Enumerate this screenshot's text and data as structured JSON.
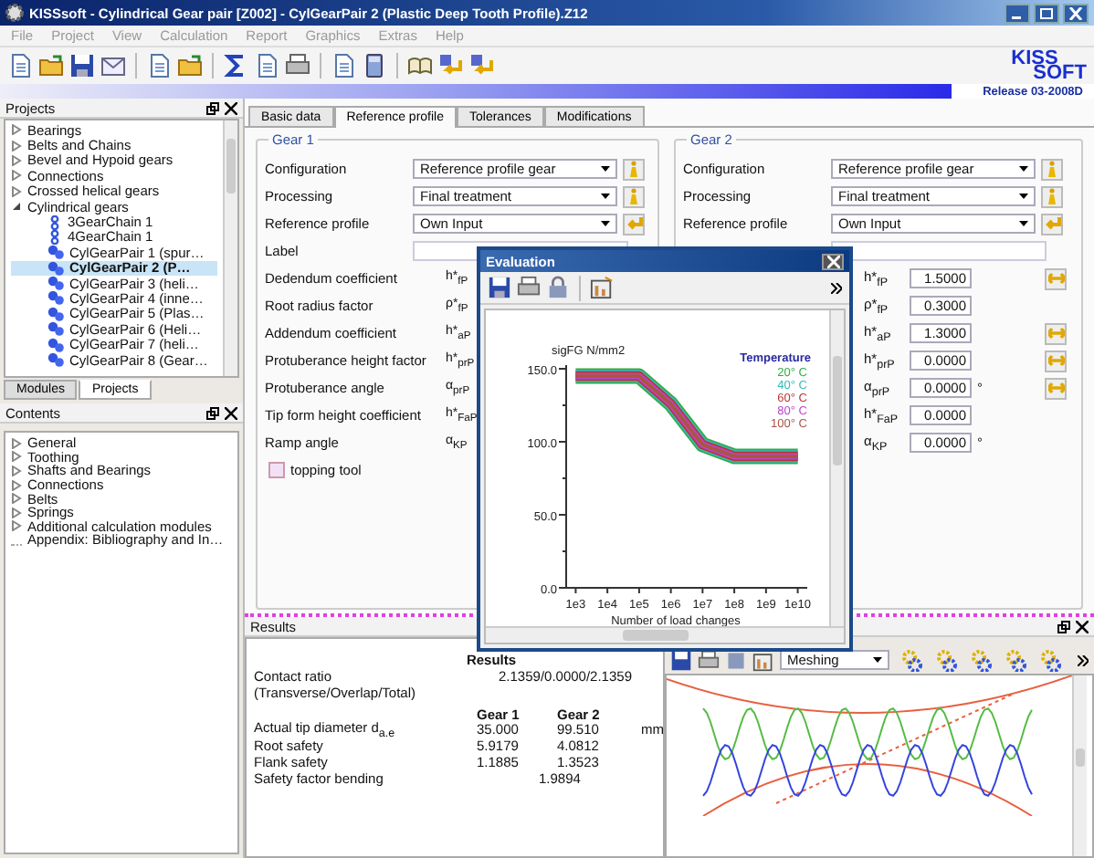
{
  "window": {
    "title": "KISSsoft - Cylindrical Gear pair [Z002] - CylGearPair 2 (Plastic Deep Tooth Profile).Z12"
  },
  "menu": [
    "File",
    "Project",
    "View",
    "Calculation",
    "Report",
    "Graphics",
    "Extras",
    "Help"
  ],
  "logo": {
    "top": "KISS",
    "bottom": "SOFT"
  },
  "release": "Release 03-2008D",
  "projects_panel": {
    "title": "Projects",
    "tree": [
      {
        "label": "Bearings",
        "expanded": false
      },
      {
        "label": "Belts and Chains",
        "expanded": false
      },
      {
        "label": "Bevel and Hypoid gears",
        "expanded": false
      },
      {
        "label": "Connections",
        "expanded": false
      },
      {
        "label": "Crossed helical gears",
        "expanded": false
      },
      {
        "label": "Cylindrical gears",
        "expanded": true,
        "children": [
          {
            "label": "3GearChain 1",
            "kind": "chain",
            "selected": false
          },
          {
            "label": "4GearChain 1",
            "kind": "chain",
            "selected": false
          },
          {
            "label": "CylGearPair 1 (spur…",
            "kind": "pair",
            "selected": false
          },
          {
            "label": "CylGearPair 2 (P…",
            "kind": "pair",
            "selected": true
          },
          {
            "label": "CylGearPair 3 (heli…",
            "kind": "pair",
            "selected": false
          },
          {
            "label": "CylGearPair 4 (inne…",
            "kind": "pair",
            "selected": false
          },
          {
            "label": "CylGearPair 5 (Plas…",
            "kind": "pair",
            "selected": false
          },
          {
            "label": "CylGearPair 6 (Heli…",
            "kind": "pair",
            "selected": false
          },
          {
            "label": "CylGearPair 7 (heli…",
            "kind": "pair",
            "selected": false
          },
          {
            "label": "CylGearPair 8 (Gear…",
            "kind": "pair",
            "selected": false
          }
        ]
      }
    ],
    "tabs": [
      {
        "label": "Modules",
        "selected": false
      },
      {
        "label": "Projects",
        "selected": true
      }
    ]
  },
  "contents_panel": {
    "title": "Contents",
    "items": [
      {
        "label": "General",
        "kind": "folder"
      },
      {
        "label": "Toothing",
        "kind": "folder"
      },
      {
        "label": "Shafts and Bearings",
        "kind": "folder"
      },
      {
        "label": "Connections",
        "kind": "folder"
      },
      {
        "label": "Belts",
        "kind": "folder"
      },
      {
        "label": "Springs",
        "kind": "folder"
      },
      {
        "label": "Additional calculation modules",
        "kind": "folder"
      },
      {
        "label": "Appendix: Bibliography and In…",
        "kind": "leaf"
      }
    ]
  },
  "main_tabs": [
    {
      "label": "Basic data",
      "selected": false
    },
    {
      "label": "Reference profile",
      "selected": true
    },
    {
      "label": "Tolerances",
      "selected": false
    },
    {
      "label": "Modifications",
      "selected": false
    }
  ],
  "gear1": {
    "title": "Gear 1",
    "selects": [
      {
        "label": "Configuration",
        "value": "Reference profile gear",
        "kind": "info"
      },
      {
        "label": "Processing",
        "value": "Final treatment",
        "kind": "info"
      },
      {
        "label": "Reference profile",
        "value": "Own Input",
        "kind": "arrow"
      }
    ],
    "label_field": {
      "label": "Label"
    },
    "coefficients": [
      {
        "label": "Dedendum coefficient",
        "symbol": "h*$_{fP}$"
      },
      {
        "label": "Root radius factor",
        "symbol": "ρ*$_{fP}$"
      },
      {
        "label": "Addendum coefficient",
        "symbol": "h*$_{aP}$"
      },
      {
        "label": "Protuberance height factor",
        "symbol": "h*$_{prP}$"
      },
      {
        "label": "Protuberance angle",
        "symbol": "α$_{prP}$"
      },
      {
        "label": "Tip form height coefficient",
        "symbol": "h*$_{FaP}$"
      },
      {
        "label": "Ramp angle",
        "symbol": "α$_{KP}$"
      }
    ],
    "topping_tool": {
      "label": "topping tool",
      "checked": false
    }
  },
  "gear2": {
    "title": "Gear 2",
    "selects": [
      {
        "label": "Configuration",
        "value": "Reference profile gear",
        "kind": "info"
      },
      {
        "label": "Processing",
        "value": "Final treatment",
        "kind": "info"
      },
      {
        "label": "Reference profile",
        "value": "Own Input",
        "kind": "arrow"
      }
    ],
    "coefficients": [
      {
        "symbol": "h*$_{fP}$",
        "value": "1.5000",
        "button": true
      },
      {
        "symbol": "ρ*$_{fP}$",
        "value": "0.3000",
        "button": false
      },
      {
        "symbol": "h*$_{aP}$",
        "value": "1.3000",
        "button": true
      },
      {
        "symbol": "h*$_{prP}$",
        "value": "0.0000",
        "button": true
      },
      {
        "symbol": "α$_{prP}$",
        "value": "0.0000",
        "unit": "°",
        "button": true
      },
      {
        "symbol": "h*$_{FaP}$",
        "value": "0.0000",
        "button": false
      },
      {
        "symbol": "α$_{KP}$",
        "value": "0.0000",
        "unit": "°",
        "button": false
      }
    ]
  },
  "dialog": {
    "title": "Evaluation",
    "legend_title": "Temperature",
    "chart_data": {
      "type": "line",
      "ylabel": "sigFG N/mm2",
      "xlabel": "Number of load changes",
      "categories": [
        "1e3",
        "1e4",
        "1e5",
        "1e6",
        "1e7",
        "1e8",
        "1e9",
        "1e10"
      ],
      "series": [
        {
          "name": "20° C",
          "color": "#33aa44",
          "values": [
            145,
            145,
            145,
            126,
            98,
            90,
            90,
            90
          ]
        },
        {
          "name": "40° C",
          "color": "#33bbbb",
          "values": [
            145,
            145,
            145,
            126,
            98,
            90,
            90,
            90
          ]
        },
        {
          "name": "60° C",
          "color": "#bb3333",
          "values": [
            145,
            145,
            145,
            126,
            98,
            90,
            90,
            90
          ]
        },
        {
          "name": "80° C",
          "color": "#bb44cc",
          "values": [
            145,
            145,
            145,
            126,
            98,
            90,
            90,
            90
          ]
        },
        {
          "name": "100° C",
          "color": "#aa5544",
          "values": [
            145,
            145,
            145,
            126,
            98,
            90,
            90,
            90
          ]
        }
      ],
      "ylim": [
        0,
        150
      ],
      "yticks": [
        {
          "value": 0,
          "label": "0.0"
        },
        {
          "value": 50,
          "label": "50.0"
        },
        {
          "value": 100,
          "label": "100.0"
        },
        {
          "value": 150,
          "label": "150.0"
        }
      ]
    }
  },
  "results_panel": {
    "title": "Results",
    "heading": "Results",
    "contact_ratio": {
      "label": "Contact ratio",
      "note": "(Transverse/Overlap/Total)",
      "value": "2.1359/0.0000/2.1359"
    },
    "columns": [
      "Gear 1",
      "Gear 2"
    ],
    "rows": [
      {
        "label": "Actual tip diameter d$_{a.e}$",
        "values": [
          "35.000",
          "99.510"
        ],
        "unit": "mm"
      },
      {
        "label": "Root safety",
        "values": [
          "5.9179",
          "4.0812"
        ]
      },
      {
        "label": "Flank safety",
        "values": [
          "1.1885",
          "1.3523"
        ]
      }
    ],
    "bending": {
      "label": "Safety factor bending",
      "value": "1.9894"
    }
  },
  "graphics_panel": {
    "view_select": "Meshing"
  }
}
